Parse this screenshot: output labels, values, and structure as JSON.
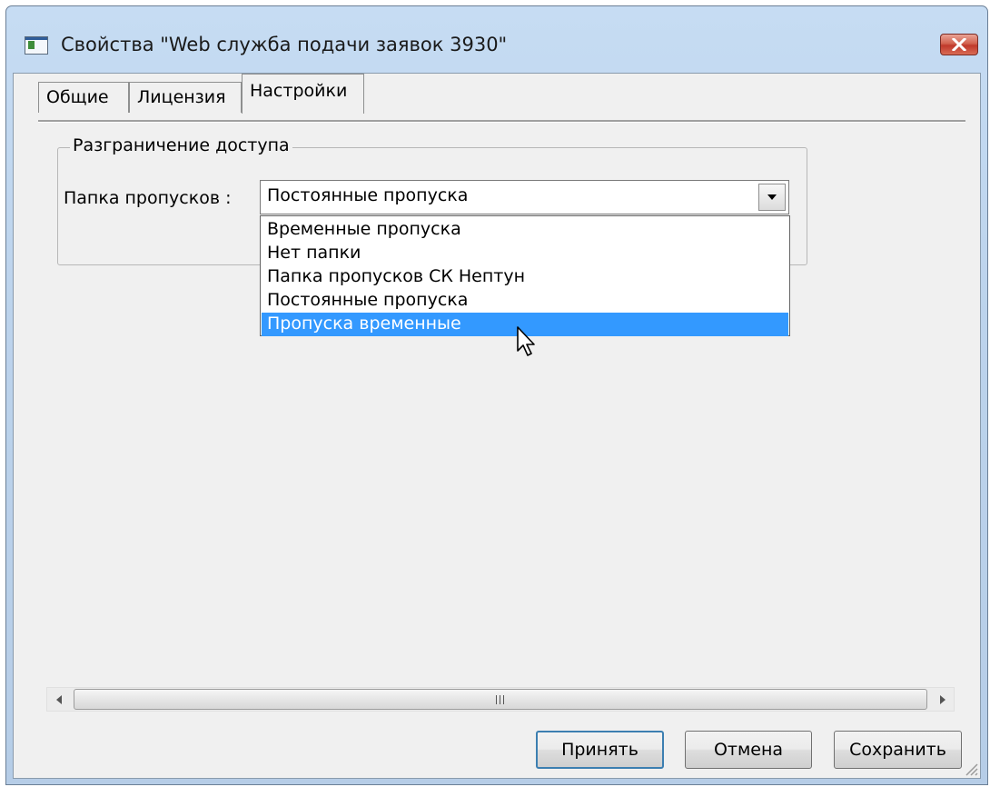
{
  "window": {
    "title": "Свойства  \"Web служба подачи заявок 3930\""
  },
  "tabs": [
    {
      "label": "Общие"
    },
    {
      "label": "Лицензия"
    },
    {
      "label": "Настройки"
    }
  ],
  "active_tab": "Настройки",
  "group": {
    "legend": "Разграничение доступа",
    "field_label": "Папка пропусков :",
    "combo_value": "Постоянные пропуска",
    "options": [
      {
        "label": "Временные пропуска"
      },
      {
        "label": "Нет папки"
      },
      {
        "label": "Папка пропусков СК Нептун"
      },
      {
        "label": "Постоянные пропуска"
      },
      {
        "label": "Пропуска временные"
      }
    ],
    "highlighted_option": "Пропуска временные"
  },
  "buttons": {
    "apply": "Принять",
    "cancel": "Отмена",
    "save": "Сохранить"
  },
  "colors": {
    "selection": "#3399ff",
    "titlebar": "#bcd3ec",
    "close_button": "#c0392b"
  },
  "icons": {
    "window_icon": "app-window-icon",
    "close": "close-icon",
    "dropdown": "chevron-down-icon",
    "cursor": "mouse-pointer-icon"
  }
}
